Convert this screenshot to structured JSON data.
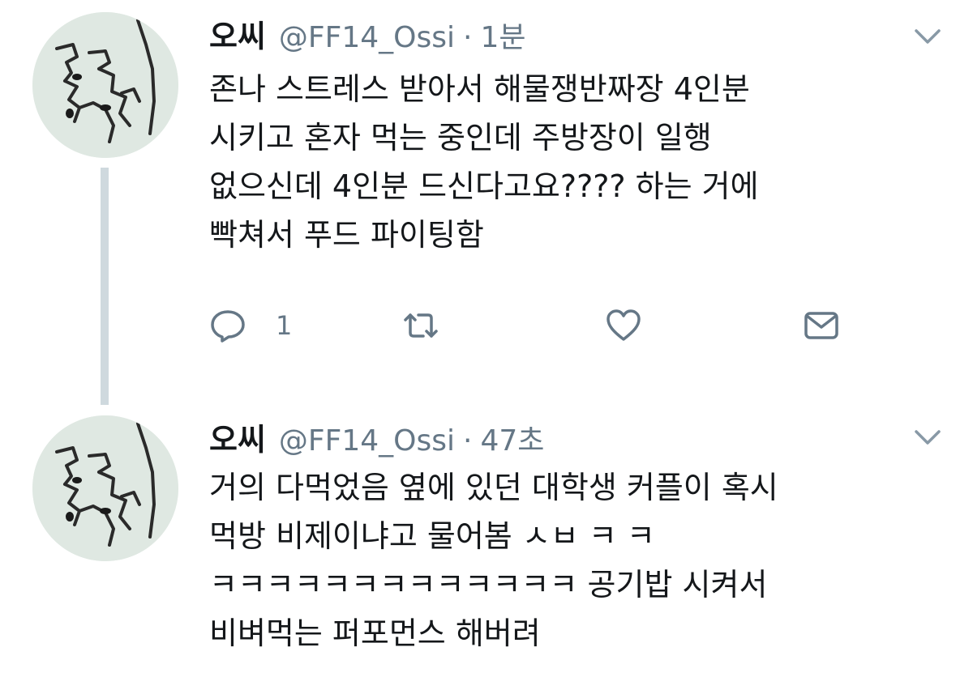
{
  "tweets": [
    {
      "author": {
        "display_name": "오씨",
        "handle": "@FF14_Ossi"
      },
      "separator": "·",
      "time": "1분",
      "text_lines": [
        "존나 스트레스 받아서 해물쟁반짜장 4인분",
        "시키고 혼자 먹는 중인데 주방장이 일행",
        "없으신데 4인분 드신다고요???? 하는 거에",
        "빡쳐서 푸드 파이팅함"
      ],
      "actions": {
        "reply_count": "1"
      },
      "icons": [
        "reply-icon",
        "retweet-icon",
        "like-icon",
        "direct-message-icon",
        "chevron-down-icon"
      ]
    },
    {
      "author": {
        "display_name": "오씨",
        "handle": "@FF14_Ossi"
      },
      "separator": "·",
      "time": "47초",
      "text_lines": [
        "거의 다먹었음 옆에 있던 대학생 커플이 혹시",
        "먹방 비제이냐고 물어봄 ㅅㅂ ㅋ ㅋ",
        "ㅋㅋㅋㅋㅋㅋㅋㅋㅋㅋㅋㅋㅋ 공기밥 시켜서",
        "비벼먹는 퍼포먼스 해버려"
      ]
    }
  ],
  "colors": {
    "text_primary": "#14171a",
    "text_secondary": "#657786",
    "thread_line": "#cfd9de",
    "icon": "#657786",
    "background": "#ffffff"
  }
}
